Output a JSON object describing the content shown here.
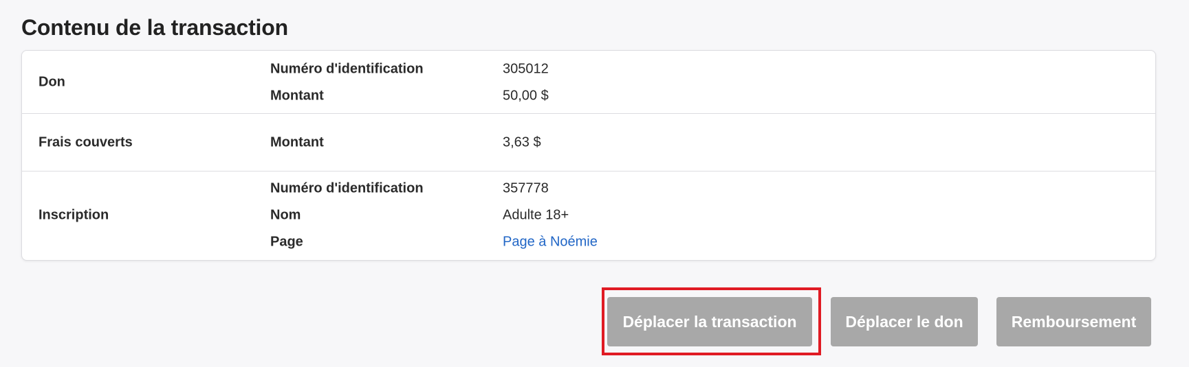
{
  "section": {
    "title": "Contenu de la transaction"
  },
  "rows": {
    "don": {
      "label": "Don",
      "fields": [
        {
          "label": "Numéro d'identification",
          "value": "305012"
        },
        {
          "label": "Montant",
          "value": "50,00 $"
        }
      ]
    },
    "frais": {
      "label": "Frais couverts",
      "fields": [
        {
          "label": "Montant",
          "value": "3,63 $"
        }
      ]
    },
    "inscription": {
      "label": "Inscription",
      "fields": [
        {
          "label": "Numéro d'identification",
          "value": "357778"
        },
        {
          "label": "Nom",
          "value": "Adulte 18+"
        },
        {
          "label": "Page",
          "value": "Page à Noémie"
        }
      ]
    }
  },
  "actions": {
    "move_transaction": "Déplacer la transaction",
    "move_don": "Déplacer le don",
    "refund": "Remboursement"
  },
  "colors": {
    "button_bg": "#a8a8a8",
    "link": "#2166c6",
    "highlight": "#e01b24"
  }
}
